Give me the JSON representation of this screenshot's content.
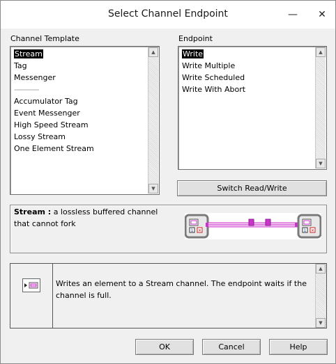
{
  "window": {
    "title": "Select Channel Endpoint",
    "minimize_glyph": "—",
    "close_glyph": "✕"
  },
  "channel_template": {
    "label": "Channel Template",
    "items": [
      "Stream",
      "Tag",
      "Messenger",
      "------------",
      "Accumulator Tag",
      "Event Messenger",
      "High Speed Stream",
      "Lossy Stream",
      "One Element Stream"
    ],
    "selected": "Stream"
  },
  "endpoint": {
    "label": "Endpoint",
    "items": [
      "Write",
      "Write Multiple",
      "Write Scheduled",
      "Write With Abort"
    ],
    "selected": "Write"
  },
  "switch_button": "Switch Read/Write",
  "description": {
    "name": "Stream :",
    "text": "a lossless buffered channel that cannot fork"
  },
  "help": {
    "text": "Writes an element to a Stream channel. The endpoint waits if the channel is full."
  },
  "buttons": {
    "ok": "OK",
    "cancel": "Cancel",
    "help": "Help"
  },
  "colors": {
    "wire": "#cc33cc",
    "selection": "#000000"
  }
}
